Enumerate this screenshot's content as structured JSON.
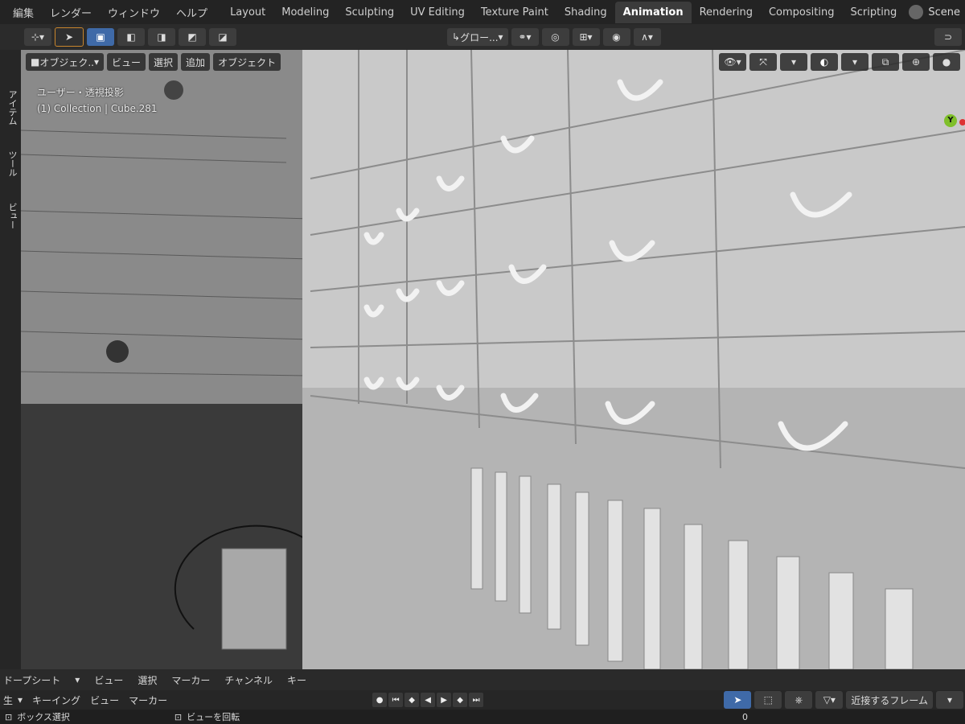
{
  "topbar": {
    "menus": [
      "編集",
      "レンダー",
      "ウィンドウ",
      "ヘルプ"
    ],
    "tabs": [
      "Layout",
      "Modeling",
      "Sculpting",
      "UV Editing",
      "Texture Paint",
      "Shading",
      "Animation",
      "Rendering",
      "Compositing",
      "Scripting"
    ],
    "active_tab": "Animation",
    "scene_label": "Scene"
  },
  "header": {
    "transform_orientation": "グロー...",
    "snap_label": ""
  },
  "viewport_header": {
    "mode": "オブジェク..",
    "menu": [
      "ビュー",
      "選択",
      "追加",
      "オブジェクト"
    ]
  },
  "viewport": {
    "view_name": "ユーザー・透視投影",
    "collection_info": "(1) Collection | Cube.281",
    "gizmo_label": "Y"
  },
  "left_tabs": [
    "アイテム",
    "ツール",
    "ビュー"
  ],
  "dopesheet": {
    "editor": "ドープシート",
    "menu": [
      "ビュー",
      "選択",
      "マーカー",
      "チャンネル",
      "キー"
    ]
  },
  "timeline": {
    "prefix": "生",
    "menu": [
      "キーイング",
      "ビュー",
      "マーカー"
    ],
    "snap_mode": "近接するフレーム"
  },
  "status": {
    "left": "ボックス選択",
    "mid": "ビューを回転",
    "right": "0"
  },
  "colors": {
    "accent_blue": "#3f6aa8",
    "orange": "#c8852c",
    "gizmo_y": "#7fbf2a",
    "gizmo_x": "#dd3333"
  }
}
